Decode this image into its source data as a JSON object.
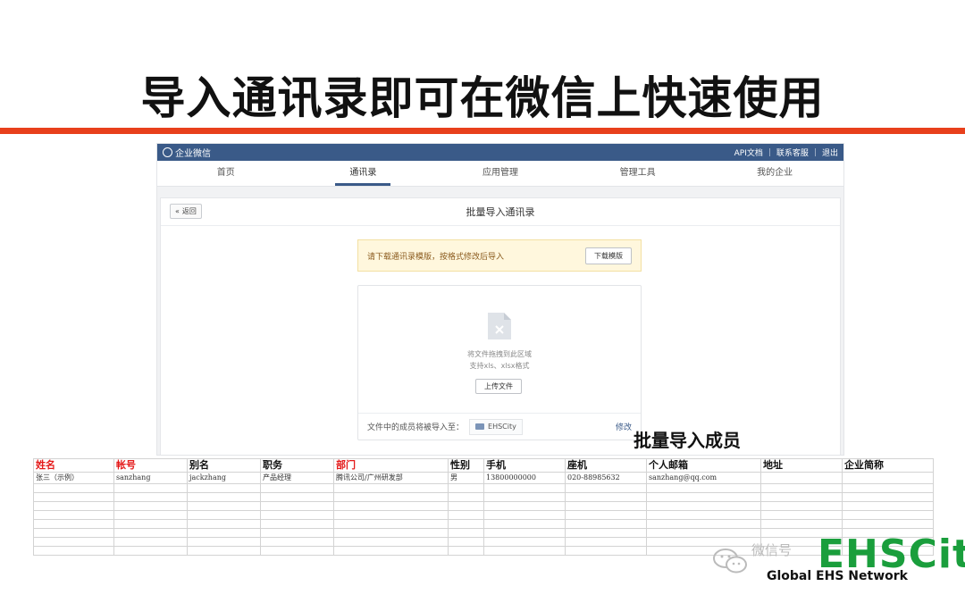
{
  "slide": {
    "title": "导入通讯录即可在微信上快速使用",
    "caption": "批量导入成员"
  },
  "app": {
    "brand": "企业微信",
    "top_links": [
      "API文档",
      "联系客服",
      "退出"
    ],
    "nav": [
      "首页",
      "通讯录",
      "应用管理",
      "管理工具",
      "我的企业"
    ],
    "active_nav": "通讯录",
    "back_label": "返回",
    "panel_title": "批量导入通讯录",
    "notice_text": "请下载通讯录模版，按格式修改后导入",
    "download_label": "下载模版",
    "drop_text": "将文件拖拽到此区域",
    "formats_text": "支持xls、xlsx格式",
    "upload_label": "上传文件",
    "import_to_label": "文件中的成员将被导入至：",
    "department": "EHSCity",
    "modify_label": "修改"
  },
  "sheet": {
    "headers": [
      "姓名",
      "帐号",
      "别名",
      "职务",
      "部门",
      "性别",
      "手机",
      "座机",
      "个人邮箱",
      "地址",
      "企业简称"
    ],
    "required_headers": [
      "姓名",
      "帐号",
      "部门"
    ],
    "example_row": [
      "张三（示例）",
      "sanzhang",
      "jackzhang",
      "产品经理",
      "腾讯公司/广州研发部",
      "男",
      "13800000000",
      "020-88985632",
      "sanzhang@qq.com",
      "",
      ""
    ]
  },
  "logo": {
    "wechat_text": "微信号",
    "brand": "EHSCity",
    "tagline": "Global EHS Network"
  },
  "colors": {
    "accent_red": "#e8401c",
    "header_blue": "#3a5a88",
    "required_red": "#e41a1a",
    "logo_green": "#1a9e3c"
  }
}
